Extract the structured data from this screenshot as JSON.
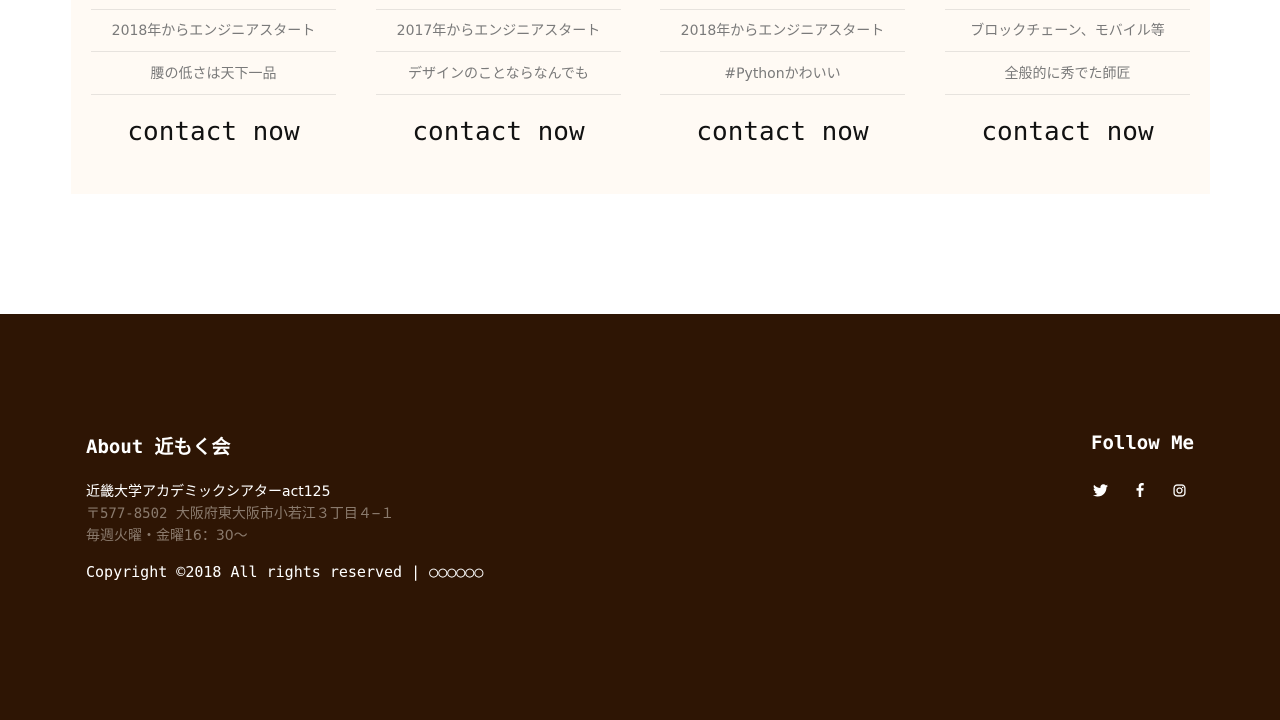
{
  "cards": [
    {
      "row1": "2018年からエンジニアスタート",
      "row2": "腰の低さは天下一品",
      "contact": "contact now"
    },
    {
      "row1": "2017年からエンジニアスタート",
      "row2": "デザインのことならなんでも",
      "contact": "contact now"
    },
    {
      "row1": "2018年からエンジニアスタート",
      "row2": "#Pythonかわいい",
      "contact": "contact now"
    },
    {
      "row1": "ブロックチェーン、モバイル等",
      "row2": "全般的に秀でた師匠",
      "contact": "contact now"
    }
  ],
  "footer": {
    "about_title": "About 近もく会",
    "venue": "近畿大学アカデミックシアターact125",
    "address": "〒577-8502 大阪府東大阪市小若江３丁目４−１",
    "schedule": "毎週火曜・金曜16：30〜",
    "copyright": "Copyright ©2018 All rights reserved | ○○○○○○",
    "follow_title": "Follow Me",
    "social": [
      {
        "icon": "twitter-icon"
      },
      {
        "icon": "facebook-icon"
      },
      {
        "icon": "instagram-icon"
      }
    ]
  },
  "colors": {
    "footer_bg": "#2e1504",
    "cards_bg": "#fffaf4",
    "muted_text": "#8a7a6d"
  }
}
